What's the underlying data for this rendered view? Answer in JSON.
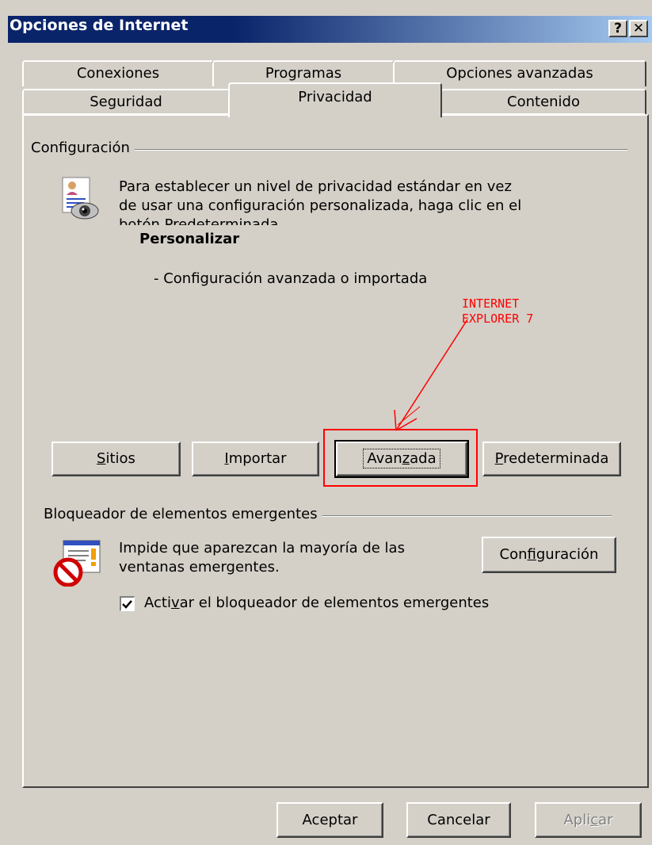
{
  "window": {
    "title": "Opciones de Internet",
    "help_glyph": "?",
    "close_glyph": "✕"
  },
  "tabs": {
    "row1": [
      "Conexiones",
      "Programas",
      "Opciones avanzadas"
    ],
    "row2": [
      "Seguridad",
      "Privacidad",
      "Contenido"
    ],
    "active": "Privacidad"
  },
  "configuracion": {
    "group_label": "Configuración",
    "description_line1": "Para establecer un nivel de privacidad estándar en vez",
    "description_line2": "de usar una configuración personalizada, haga clic en el",
    "description_line3_partial": "botón Predeterminada.",
    "level_title": "Personalizar",
    "level_desc": "- Configuración avanzada o importada",
    "icon": "privacy-eye-icon"
  },
  "annotation": {
    "line1": "INTERNET",
    "line2": "EXPLORER 7",
    "color": "#ff0000"
  },
  "buttons": {
    "sitios": {
      "pre": "",
      "key": "S",
      "post": "itios"
    },
    "importar": {
      "pre": "",
      "key": "I",
      "post": "mportar"
    },
    "avanzada": {
      "pre": "Avan",
      "key": "z",
      "post": "ada"
    },
    "predeterminada": {
      "pre": "",
      "key": "P",
      "post": "redeterminada"
    }
  },
  "popup": {
    "group_label": "Bloqueador de elementos emergentes",
    "desc_line1": "Impide que aparezcan la mayoría de las",
    "desc_line2": "ventanas emergentes.",
    "config_button": {
      "pre": "Con",
      "key": "f",
      "post": "iguración"
    },
    "checkbox": {
      "pre": "Acti",
      "key": "v",
      "post": "ar el bloqueador de elementos emergentes",
      "checked": true
    },
    "icon": "popup-blocker-icon"
  },
  "footer": {
    "aceptar": "Aceptar",
    "cancelar": "Cancelar",
    "aplicar": {
      "pre": "Apli",
      "key": "c",
      "post": "ar"
    }
  }
}
